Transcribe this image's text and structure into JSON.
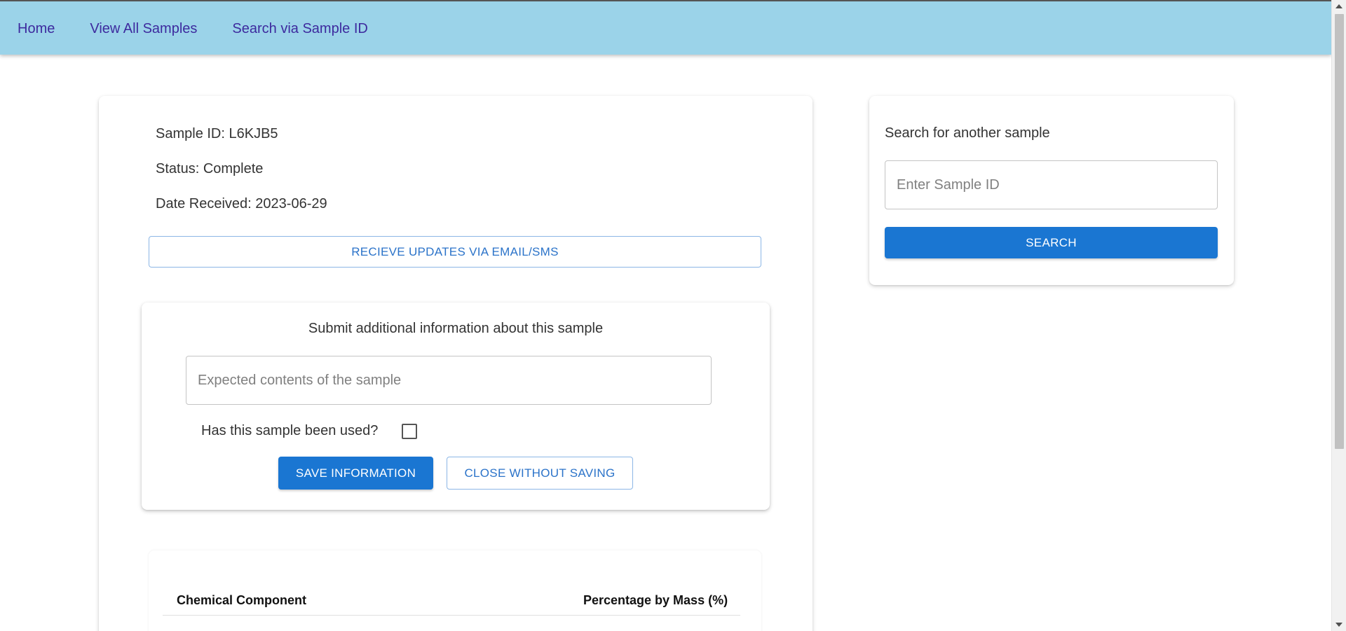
{
  "nav": {
    "home": "Home",
    "view_all": "View All Samples",
    "search_id": "Search via Sample ID"
  },
  "sample": {
    "id_line": "Sample ID: L6KJB5",
    "status_line": "Status: Complete",
    "date_line": "Date Received: 2023-06-29",
    "updates_button": "RECIEVE UPDATES VIA EMAIL/SMS"
  },
  "submit_form": {
    "title": "Submit additional information about this sample",
    "expected_placeholder": "Expected contents of the sample",
    "expected_value": "",
    "used_label": "Has this sample been used?",
    "used_checked": false,
    "save_label": "SAVE INFORMATION",
    "close_label": "CLOSE WITHOUT SAVING"
  },
  "table": {
    "headers": [
      "Chemical Component",
      "Percentage by Mass (%)"
    ]
  },
  "search": {
    "title": "Search for another sample",
    "placeholder": "Enter Sample ID",
    "value": "",
    "button_label": "SEARCH"
  },
  "colors": {
    "navbar": "#9bd3e9",
    "nav_link": "#3d2a9e",
    "primary": "#1a76d2",
    "outline_text": "#2b73c9"
  }
}
